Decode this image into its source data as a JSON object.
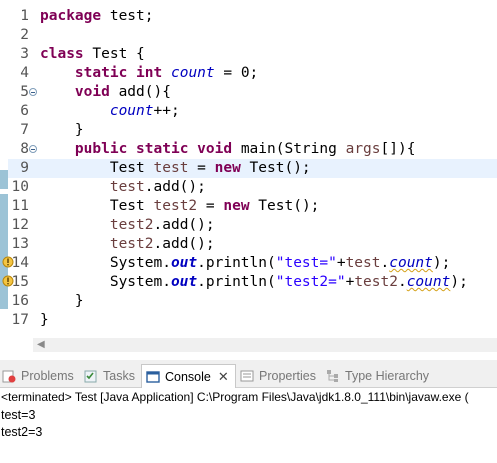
{
  "editor": {
    "lines": [
      {
        "n": "1"
      },
      {
        "n": "2"
      },
      {
        "n": "3"
      },
      {
        "n": "4"
      },
      {
        "n": "5"
      },
      {
        "n": "6"
      },
      {
        "n": "7"
      },
      {
        "n": "8"
      },
      {
        "n": "9"
      },
      {
        "n": "10"
      },
      {
        "n": "11"
      },
      {
        "n": "12"
      },
      {
        "n": "13"
      },
      {
        "n": "14"
      },
      {
        "n": "15"
      },
      {
        "n": "16"
      },
      {
        "n": "17"
      }
    ],
    "code": {
      "l1_kw": "package",
      "l1_rest": " test;",
      "l3_kw": "class",
      "l3_rest": " Test {",
      "l4_kw1": "static",
      "l4_kw2": "int",
      "l4_field": "count",
      "l4_rest": " = 0;",
      "l5_kw": "void",
      "l5_rest": " add(){",
      "l6_field": "count",
      "l6_rest": "++;",
      "l7": "}",
      "l8_kw1": "public",
      "l8_kw2": "static",
      "l8_kw3": "void",
      "l8_mid": " main(String ",
      "l8_var": "args",
      "l8_rest": "[]){",
      "l9_a": "Test ",
      "l9_var": "test",
      "l9_b": " = ",
      "l9_kw": "new",
      "l9_c": " Test();",
      "l10_var": "test",
      "l10_rest": ".add();",
      "l11_a": "Test ",
      "l11_var": "test2",
      "l11_b": " = ",
      "l11_kw": "new",
      "l11_c": " Test();",
      "l12_var": "test2",
      "l12_rest": ".add();",
      "l13_var": "test2",
      "l13_rest": ".add();",
      "l14_a": "System.",
      "l14_out": "out",
      "l14_b": ".println(",
      "l14_str": "\"test=\"",
      "l14_c": "+",
      "l14_var": "test",
      "l14_d": ".",
      "l14_field": "count",
      "l14_e": ");",
      "l15_a": "System.",
      "l15_out": "out",
      "l15_b": ".println(",
      "l15_str": "\"test2=\"",
      "l15_c": "+",
      "l15_var": "test2",
      "l15_d": ".",
      "l15_field": "count",
      "l15_e": ");",
      "l16": "}",
      "l17": "}"
    }
  },
  "views": {
    "tabs": [
      {
        "label": "Problems"
      },
      {
        "label": "Tasks"
      },
      {
        "label": "Console"
      },
      {
        "label": "Properties"
      },
      {
        "label": "Type Hierarchy"
      }
    ],
    "terminated": "<terminated> Test [Java Application] C:\\Program Files\\Java\\jdk1.8.0_111\\bin\\javaw.exe (",
    "output": [
      "test=3",
      "test2=3"
    ]
  },
  "colors": {
    "keyword": "#7f0055",
    "field": "#0000c0",
    "string": "#2a00ff",
    "local_var": "#6a3e3e",
    "current_line": "#e8f2fe",
    "warning": "#d4a017"
  }
}
